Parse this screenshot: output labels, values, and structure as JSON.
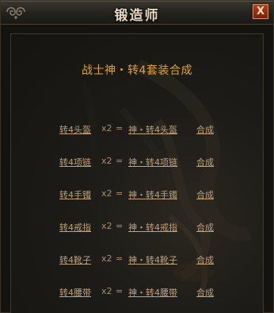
{
  "window": {
    "title": "锻造师",
    "close_label": "X"
  },
  "panel": {
    "heading": "战士神・转4套装合成",
    "recipes": [
      {
        "material": "转4头盔",
        "quantity": "x2",
        "equals": "=",
        "result": "神・转4头盔",
        "action": "合成"
      },
      {
        "material": "转4项链",
        "quantity": "x2",
        "equals": "=",
        "result": "神・转4项链",
        "action": "合成"
      },
      {
        "material": "转4手镯",
        "quantity": "x2",
        "equals": "=",
        "result": "神・转4手镯",
        "action": "合成"
      },
      {
        "material": "转4戒指",
        "quantity": "x2",
        "equals": "=",
        "result": "神・转4戒指",
        "action": "合成"
      },
      {
        "material": "转4靴子",
        "quantity": "x2",
        "equals": "=",
        "result": "神・转4靴子",
        "action": "合成"
      },
      {
        "material": "转4腰带",
        "quantity": "x2",
        "equals": "=",
        "result": "神・转4腰带",
        "action": "合成"
      }
    ]
  },
  "colors": {
    "heading": "#e1a52c",
    "link_text": "#bfa27a",
    "close_button": "#9c2f12"
  },
  "icons": {
    "title_ornament": "swirl-ornament-icon"
  }
}
